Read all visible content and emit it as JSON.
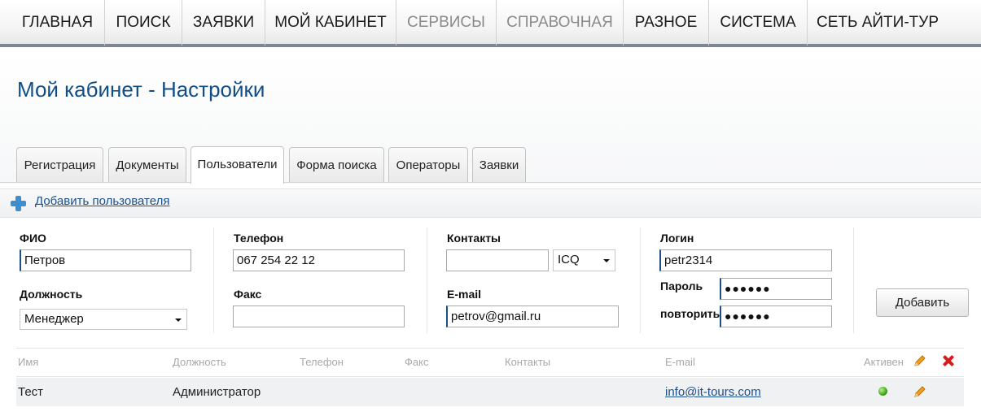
{
  "nav": {
    "items": [
      {
        "label": "ГЛАВНАЯ"
      },
      {
        "label": "ПОИСК"
      },
      {
        "label": "ЗАЯВКИ"
      },
      {
        "label": "МОЙ КАБИНЕТ"
      },
      {
        "label": "СЕРВИСЫ"
      },
      {
        "label": "СПРАВОЧНАЯ"
      },
      {
        "label": "РАЗНОЕ"
      },
      {
        "label": "СИСТЕМА"
      },
      {
        "label": "СЕТЬ АЙТИ-ТУР"
      }
    ]
  },
  "page_title": "Мой кабинет - Настройки",
  "tabs": [
    {
      "label": "Регистрация"
    },
    {
      "label": "Документы"
    },
    {
      "label": "Пользователи",
      "active": true
    },
    {
      "label": "Форма поиска"
    },
    {
      "label": "Операторы"
    },
    {
      "label": "Заявки"
    }
  ],
  "add_user_link": "Добавить пользователя",
  "form": {
    "fio_label": "ФИО",
    "fio_value": "Петров",
    "position_label": "Должность",
    "position_value": "Менеджер",
    "phone_label": "Телефон",
    "phone_value": "067 254 22 12",
    "fax_label": "Факс",
    "fax_value": "",
    "contacts_label": "Контакты",
    "contacts_value": "",
    "contacts_type": "ICQ",
    "email_label": "E-mail",
    "email_value": "petrov@gmail.ru",
    "login_label": "Логин",
    "login_value": "petr2314",
    "password_label": "Пароль",
    "password_value": "●●●●●●",
    "repeat_label": "повторить",
    "repeat_value": "●●●●●●",
    "submit_label": "Добавить"
  },
  "table": {
    "headers": {
      "name": "Имя",
      "position": "Должность",
      "phone": "Телефон",
      "fax": "Факс",
      "contacts": "Контакты",
      "email": "E-mail",
      "active": "Активен"
    },
    "rows": [
      {
        "name": "Тест",
        "position": "Администратор",
        "phone": "",
        "fax": "",
        "contacts": "",
        "email": "info@it-tours.com",
        "active": true
      }
    ]
  },
  "colors": {
    "title": "#124e86",
    "link": "#1d4f8c",
    "active_dot": "#3b9e14",
    "delete": "#d81c1c",
    "edit": "#e8941a"
  }
}
